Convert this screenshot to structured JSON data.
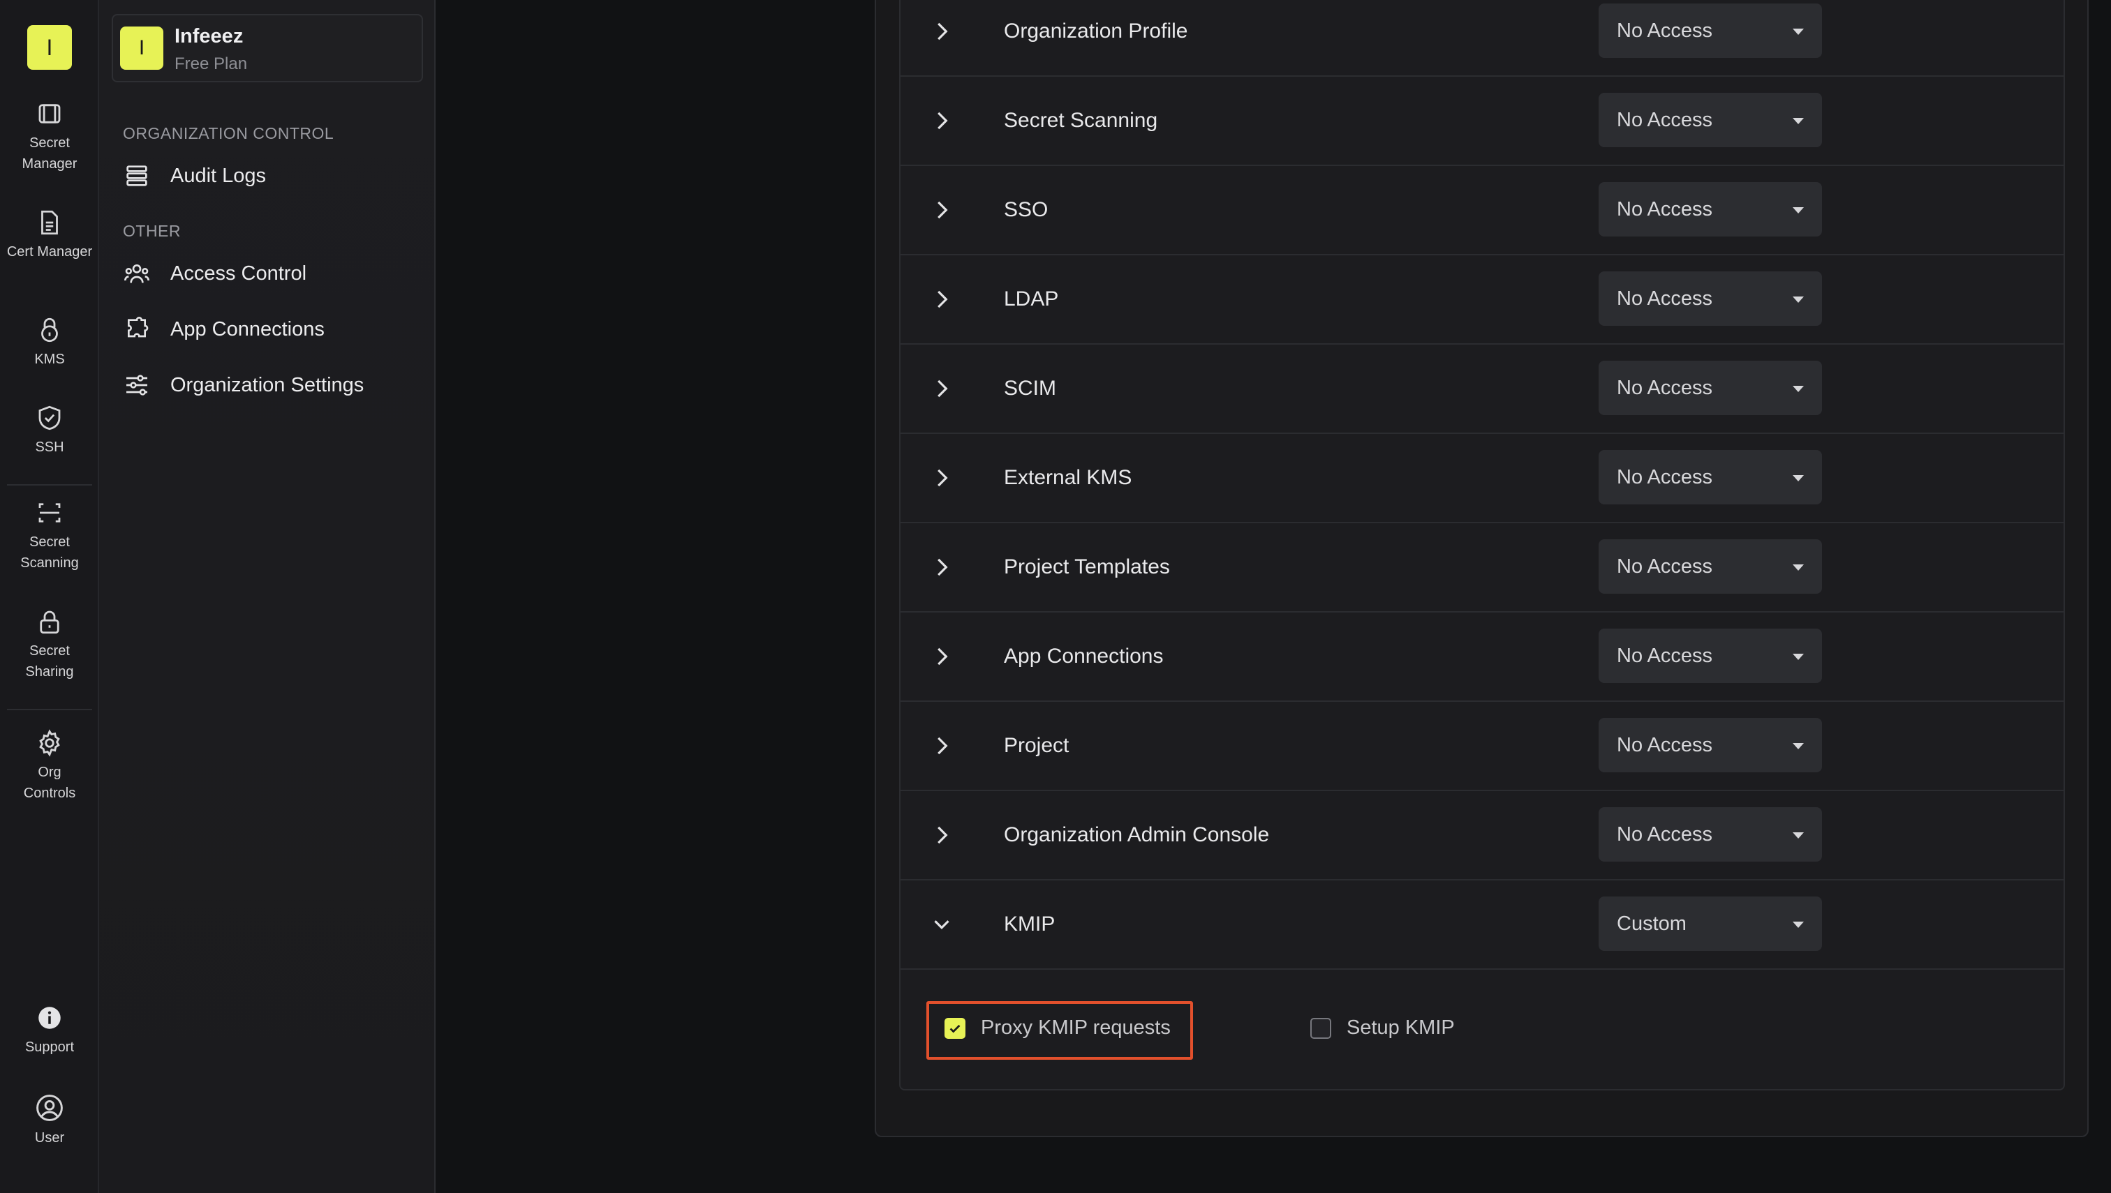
{
  "rail": {
    "logo_letter": "I",
    "items": [
      {
        "label": "Secret Manager",
        "icon": "vault-icon"
      },
      {
        "label": "Cert Manager",
        "icon": "certificate-icon"
      },
      {
        "label": "KMS",
        "icon": "lock-key-icon"
      },
      {
        "label": "SSH",
        "icon": "shield-check-icon"
      },
      {
        "label": "Secret Scanning",
        "icon": "scan-icon"
      },
      {
        "label": "Secret Sharing",
        "icon": "padlock-icon"
      },
      {
        "label": "Org Controls",
        "icon": "gear-icon"
      },
      {
        "label": "Support",
        "icon": "info-icon"
      },
      {
        "label": "User",
        "icon": "user-circle-icon"
      }
    ]
  },
  "sidebar": {
    "org_avatar_letter": "I",
    "org_name": "Infeeez",
    "org_plan": "Free Plan",
    "section_org_control": "ORGANIZATION CONTROL",
    "section_other": "OTHER",
    "items": [
      {
        "label": "Audit Logs",
        "icon": "list-icon"
      },
      {
        "label": "Access Control",
        "icon": "users-icon"
      },
      {
        "label": "App Connections",
        "icon": "puzzle-icon"
      },
      {
        "label": "Organization Settings",
        "icon": "sliders-icon"
      }
    ]
  },
  "permissions": {
    "rows": [
      {
        "name": "Organization Profile",
        "access": "No Access",
        "expanded": false
      },
      {
        "name": "Secret Scanning",
        "access": "No Access",
        "expanded": false
      },
      {
        "name": "SSO",
        "access": "No Access",
        "expanded": false
      },
      {
        "name": "LDAP",
        "access": "No Access",
        "expanded": false
      },
      {
        "name": "SCIM",
        "access": "No Access",
        "expanded": false
      },
      {
        "name": "External KMS",
        "access": "No Access",
        "expanded": false
      },
      {
        "name": "Project Templates",
        "access": "No Access",
        "expanded": false
      },
      {
        "name": "App Connections",
        "access": "No Access",
        "expanded": false
      },
      {
        "name": "Project",
        "access": "No Access",
        "expanded": false
      },
      {
        "name": "Organization Admin Console",
        "access": "No Access",
        "expanded": false
      },
      {
        "name": "KMIP",
        "access": "Custom",
        "expanded": true
      }
    ],
    "kmip_options": [
      {
        "label": "Proxy KMIP requests",
        "checked": true
      },
      {
        "label": "Setup KMIP",
        "checked": false
      }
    ]
  },
  "colors": {
    "accent": "#e7f256",
    "highlight": "#e2502c"
  }
}
